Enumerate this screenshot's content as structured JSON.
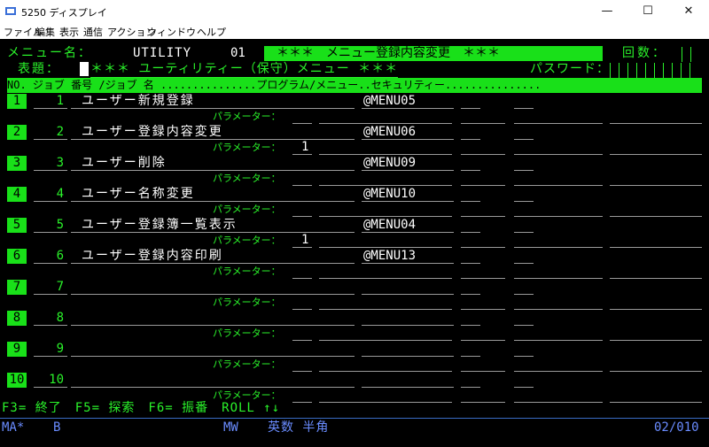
{
  "window": {
    "title": "5250 ディスプレイ",
    "minimize": "—",
    "maximize": "☐",
    "close": "✕"
  },
  "menu": [
    "ファイル",
    "編集",
    "表示",
    "通信",
    "アクション",
    "ウィンドウ",
    "ヘルプ"
  ],
  "header": {
    "menu_name_label": "メニュー名：",
    "menu_name_value": "UTILITY",
    "menu_num": "01",
    "screen_title": "＊＊＊　メニュー登録内容変更　＊＊＊",
    "count_label": "回数：",
    "heading_label": "表題：",
    "heading_value": "＊＊＊ ユーティリティー（保守）メニュー ＊＊＊",
    "password_label": "パスワード："
  },
  "column_header": "NO. ジョブ 番号 /ジョブ 名 ...............プログラム/メニュー..セキュリティー...............",
  "param_label": "パラメーター：",
  "rows": [
    {
      "no": "1",
      "job_no": "1",
      "name": "ユーザー新規登録",
      "program": "@MENU05",
      "param": ""
    },
    {
      "no": "2",
      "job_no": "2",
      "name": "ユーザー登録内容変更",
      "program": "@MENU06",
      "param": "1"
    },
    {
      "no": "3",
      "job_no": "3",
      "name": "ユーザー削除",
      "program": "@MENU09",
      "param": ""
    },
    {
      "no": "4",
      "job_no": "4",
      "name": "ユーザー名称変更",
      "program": "@MENU10",
      "param": ""
    },
    {
      "no": "5",
      "job_no": "5",
      "name": "ユーザー登録簿一覧表示",
      "program": "@MENU04",
      "param": "1"
    },
    {
      "no": "6",
      "job_no": "6",
      "name": "ユーザー登録内容印刷",
      "program": "@MENU13",
      "param": ""
    },
    {
      "no": "7",
      "job_no": "7",
      "name": "",
      "program": "",
      "param": ""
    },
    {
      "no": "8",
      "job_no": "8",
      "name": "",
      "program": "",
      "param": ""
    },
    {
      "no": "9",
      "job_no": "9",
      "name": "",
      "program": "",
      "param": ""
    },
    {
      "no": "10",
      "job_no": "10",
      "name": "",
      "program": "",
      "param": ""
    }
  ],
  "fkeys": "F3= 終了　F5= 探索　F6= 振番　ROLL ↑↓",
  "status": {
    "mode": "MA*",
    "b": "B",
    "mw": "MW",
    "ime": "英数 半角",
    "position": "02/010"
  },
  "colors": {
    "terminal_bg": "#000000",
    "field_green": "#2af22a",
    "highlight": "#19e019",
    "status_blue": "#6a8cff"
  }
}
